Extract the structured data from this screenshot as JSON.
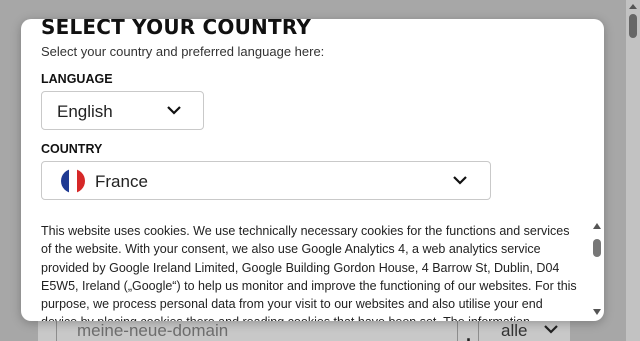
{
  "background": {
    "domain_input_placeholder": "meine-neue-domain",
    "separator": ".",
    "tld_select_value": "alle"
  },
  "modal": {
    "title": "SELECT YOUR COUNTRY",
    "subtitle": "Select your country and preferred language here:",
    "language": {
      "label": "LANGUAGE",
      "value": "English"
    },
    "country": {
      "label": "COUNTRY",
      "value": "France",
      "flag_colors": [
        "#1f3a93",
        "#ffffff",
        "#d62828"
      ]
    },
    "cookie_notice": "This website uses cookies. We use technically necessary cookies for the functions and services of the website. With your consent, we also use Google Analytics 4, a web analytics service provided by Google Ireland Limited, Google Building Gordon House, 4 Barrow St, Dublin, D04 E5W5, Ireland („Google“) to help us monitor and improve the functioning of our websites. For this purpose, we process personal data from your visit to our websites and also utilise your end device by placing cookies there and reading cookies that have been set. The information"
  },
  "icons": {
    "chevron": "chevron-down-icon",
    "flag": "flag-france-icon"
  }
}
